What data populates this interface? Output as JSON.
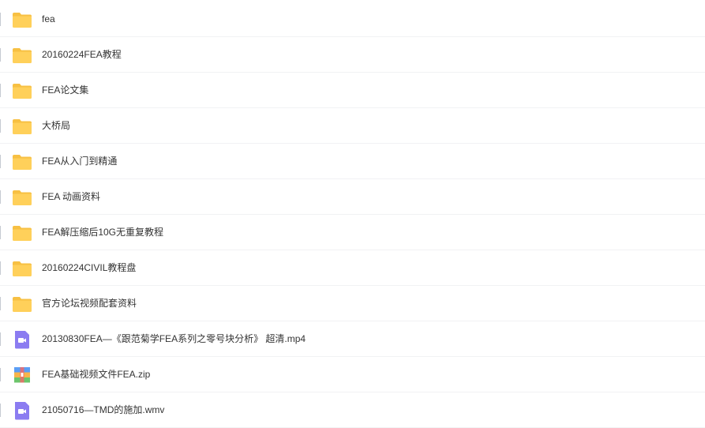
{
  "colors": {
    "folder": "#ffd05a",
    "folder_tab": "#f7c043",
    "video": "#8b7cf1",
    "zip_blue": "#5b9ef5",
    "zip_orange": "#f8b44a",
    "zip_green": "#6cc56b",
    "zip_red": "#ef6a6a"
  },
  "files": [
    {
      "name": "fea",
      "icon": "folder-icon"
    },
    {
      "name": "20160224FEA教程",
      "icon": "folder-icon"
    },
    {
      "name": "FEA论文集",
      "icon": "folder-icon"
    },
    {
      "name": "大桥局",
      "icon": "folder-icon"
    },
    {
      "name": "FEA从入门到精通",
      "icon": "folder-icon"
    },
    {
      "name": "FEA 动画资料",
      "icon": "folder-icon"
    },
    {
      "name": "FEA解压缩后10G无重复教程",
      "icon": "folder-icon"
    },
    {
      "name": "20160224CIVIL教程盘",
      "icon": "folder-icon"
    },
    {
      "name": "官方论坛视频配套资料",
      "icon": "folder-icon"
    },
    {
      "name": "20130830FEA—《跟范菊学FEA系列之零号块分析》 超清.mp4",
      "icon": "video-file-icon"
    },
    {
      "name": "FEA基础视频文件FEA.zip",
      "icon": "zip-file-icon"
    },
    {
      "name": "21050716—TMD的施加.wmv",
      "icon": "video-file-icon"
    }
  ]
}
